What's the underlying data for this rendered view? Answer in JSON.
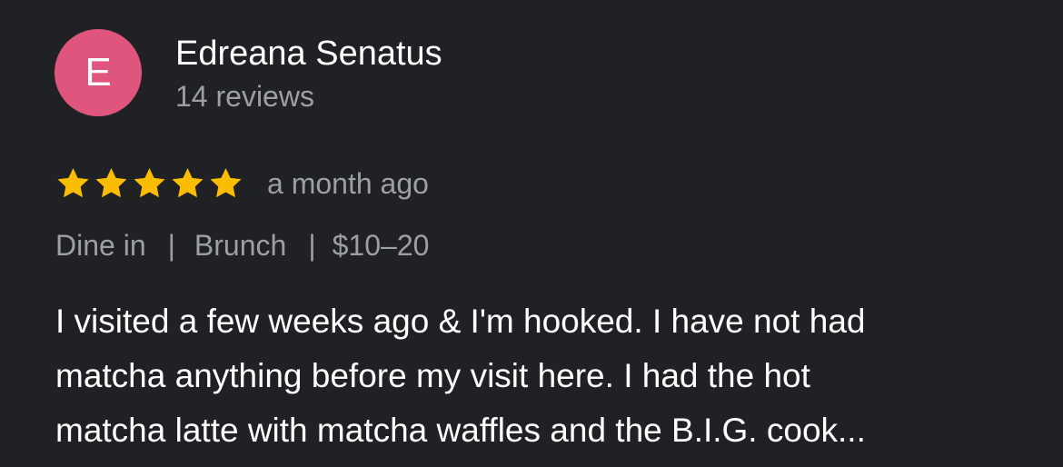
{
  "review": {
    "author": {
      "initial": "E",
      "avatar_color": "#e0557d",
      "name": "Edreana Senatus",
      "review_count": "14 reviews"
    },
    "rating": 5,
    "star_color": "#fbbc04",
    "time_ago": "a month ago",
    "tags": {
      "service": "Dine in",
      "meal": "Brunch",
      "price": "$10–20",
      "separator": "|"
    },
    "text_lines": [
      "I visited a few weeks ago & I'm hooked. I have not had",
      "matcha anything before my visit here. I had the hot",
      "matcha latte with matcha waffles and the B.I.G. cook..."
    ]
  }
}
